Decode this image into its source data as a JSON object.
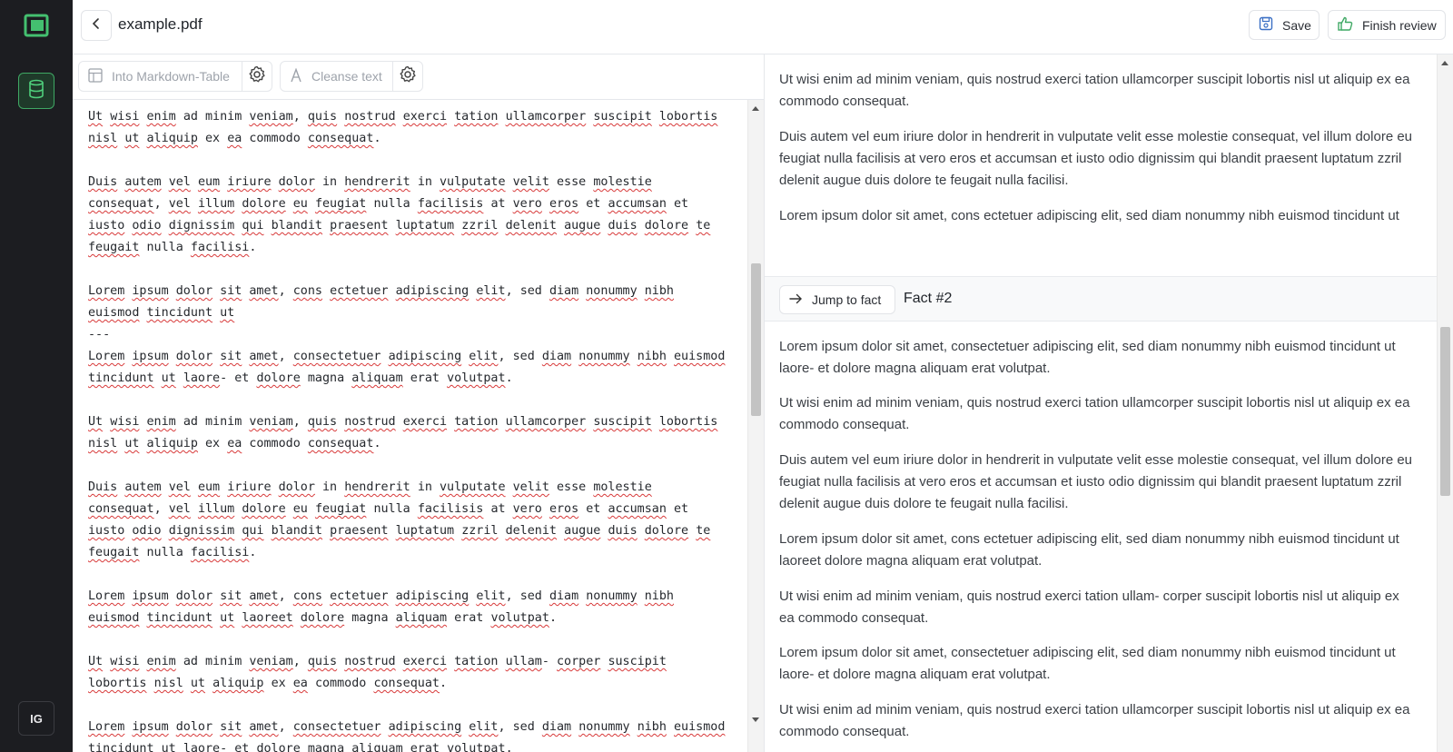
{
  "header": {
    "file_name": "example.pdf",
    "save_label": "Save",
    "finish_label": "Finish review"
  },
  "toolbar": {
    "markdown_table_label": "Into Markdown-Table",
    "cleanse_text_label": "Cleanse text"
  },
  "sidebar": {
    "avatar_initials": "IG"
  },
  "editor": {
    "lines": [
      "Ut wisi enim ad minim veniam, quis nostrud exerci tation ullamcorper suscipit lobortis nisl ut aliquip ex ea commodo consequat.",
      "",
      "Duis autem vel eum iriure dolor in hendrerit in vulputate velit esse molestie consequat, vel illum dolore eu feugiat nulla facilisis at vero eros et accumsan et iusto odio dignissim qui blandit praesent luptatum zzril delenit augue duis dolore te feugait nulla facilisi.",
      "",
      "Lorem ipsum dolor sit amet, cons ectetuer adipiscing elit, sed diam nonummy nibh euismod tincidunt ut",
      "---",
      "Lorem ipsum dolor sit amet, consectetuer adipiscing elit, sed diam nonummy nibh euismod tincidunt ut laore- et dolore magna aliquam erat volutpat.",
      "",
      "Ut wisi enim ad minim veniam, quis nostrud exerci tation ullamcorper suscipit lobortis nisl ut aliquip ex ea commodo consequat.",
      "",
      "Duis autem vel eum iriure dolor in hendrerit in vulputate velit esse molestie consequat, vel illum dolore eu feugiat nulla facilisis at vero eros et accumsan et iusto odio dignissim qui blandit praesent luptatum zzril delenit augue duis dolore te feugait nulla facilisi.",
      "",
      "Lorem ipsum dolor sit amet, cons ectetuer adipiscing elit, sed diam nonummy nibh euismod tincidunt ut laoreet dolore magna aliquam erat volutpat.",
      "",
      "Ut wisi enim ad minim veniam, quis nostrud exerci tation ullam- corper suscipit lobortis nisl ut aliquip ex ea commodo consequat.",
      "",
      "Lorem ipsum dolor sit amet, consectetuer adipiscing elit, sed diam nonummy nibh euismod tincidunt ut laore- et dolore magna aliquam erat volutpat."
    ],
    "flagged_words": [
      "Ut",
      "wisi",
      "enim",
      "veniam",
      "quis",
      "nostrud",
      "exerci",
      "tation",
      "ullamcorper",
      "suscipit",
      "lobortis",
      "nisl",
      "aliquip",
      "ea",
      "consequat",
      "Duis",
      "autem",
      "vel",
      "eum",
      "iriure",
      "dolor",
      "hendrerit",
      "vulputate",
      "velit",
      "molestie",
      "illum",
      "dolore",
      "eu",
      "feugiat",
      "facilisis",
      "vero",
      "eros",
      "accumsan",
      "iusto",
      "odio",
      "dignissim",
      "qui",
      "blandit",
      "praesent",
      "luptatum",
      "zzril",
      "delenit",
      "augue",
      "duis",
      "te",
      "feugait",
      "facilisi",
      "Lorem",
      "ipsum",
      "sit",
      "amet",
      "cons",
      "ectetuer",
      "adipiscing",
      "elit",
      "diam",
      "nonummy",
      "nibh",
      "euismod",
      "tincidunt",
      "ut",
      "consectetuer",
      "laore",
      "aliquam",
      "volutpat",
      "laoreet",
      "ullam",
      "corper"
    ]
  },
  "right_pane": {
    "top_paragraphs": [
      "Ut wisi enim ad minim veniam, quis nostrud exerci tation ullamcorper suscipit lobortis nisl ut aliquip ex ea commodo consequat.",
      "Duis autem vel eum iriure dolor in hendrerit in vulputate velit esse molestie consequat, vel illum dolore eu feugiat nulla facilisis at vero eros et accumsan et iusto odio dignissim qui blandit praesent luptatum zzril delenit augue duis dolore te feugait nulla facilisi.",
      "Lorem ipsum dolor sit amet, cons ectetuer adipiscing elit, sed diam nonummy nibh euismod tincidunt ut"
    ],
    "jump_label": "Jump to fact",
    "fact_label": "Fact #2",
    "fact_paragraphs": [
      "Lorem ipsum dolor sit amet, consectetuer adipiscing elit, sed diam nonummy nibh euismod tincidunt ut laore- et dolore magna aliquam erat volutpat.",
      "Ut wisi enim ad minim veniam, quis nostrud exerci tation ullamcorper suscipit lobortis nisl ut aliquip ex ea commodo consequat.",
      "Duis autem vel eum iriure dolor in hendrerit in vulputate velit esse molestie consequat, vel illum dolore eu feugiat nulla facilisis at vero eros et accumsan et iusto odio dignissim qui blandit praesent luptatum zzril delenit augue duis dolore te feugait nulla facilisi.",
      "Lorem ipsum dolor sit amet, cons ectetuer adipiscing elit, sed diam nonummy nibh euismod tincidunt ut laoreet dolore magna aliquam erat volutpat.",
      "Ut wisi enim ad minim veniam, quis nostrud exerci tation ullam- corper suscipit lobortis nisl ut aliquip ex ea commodo consequat.",
      "Lorem ipsum dolor sit amet, consectetuer adipiscing elit, sed diam nonummy nibh euismod tincidunt ut laore- et dolore magna aliquam erat volutpat.",
      "Ut wisi enim ad minim veniam, quis nostrud exerci tation ullamcorper suscipit lobortis nisl ut aliquip ex ea commodo consequat."
    ]
  },
  "colors": {
    "sidebar_bg": "#1c1d21",
    "accent_green": "#3fa864",
    "spell_error": "#d83a3a"
  },
  "icons": {
    "logo": "square-logo-icon",
    "nav": "database-icon",
    "back": "chevron-left-icon",
    "save": "save-icon",
    "finish": "thumbs-up-icon",
    "table": "table-icon",
    "cleanse": "text-letter-icon",
    "settings": "gear-icon",
    "jump": "arrow-right-icon"
  }
}
